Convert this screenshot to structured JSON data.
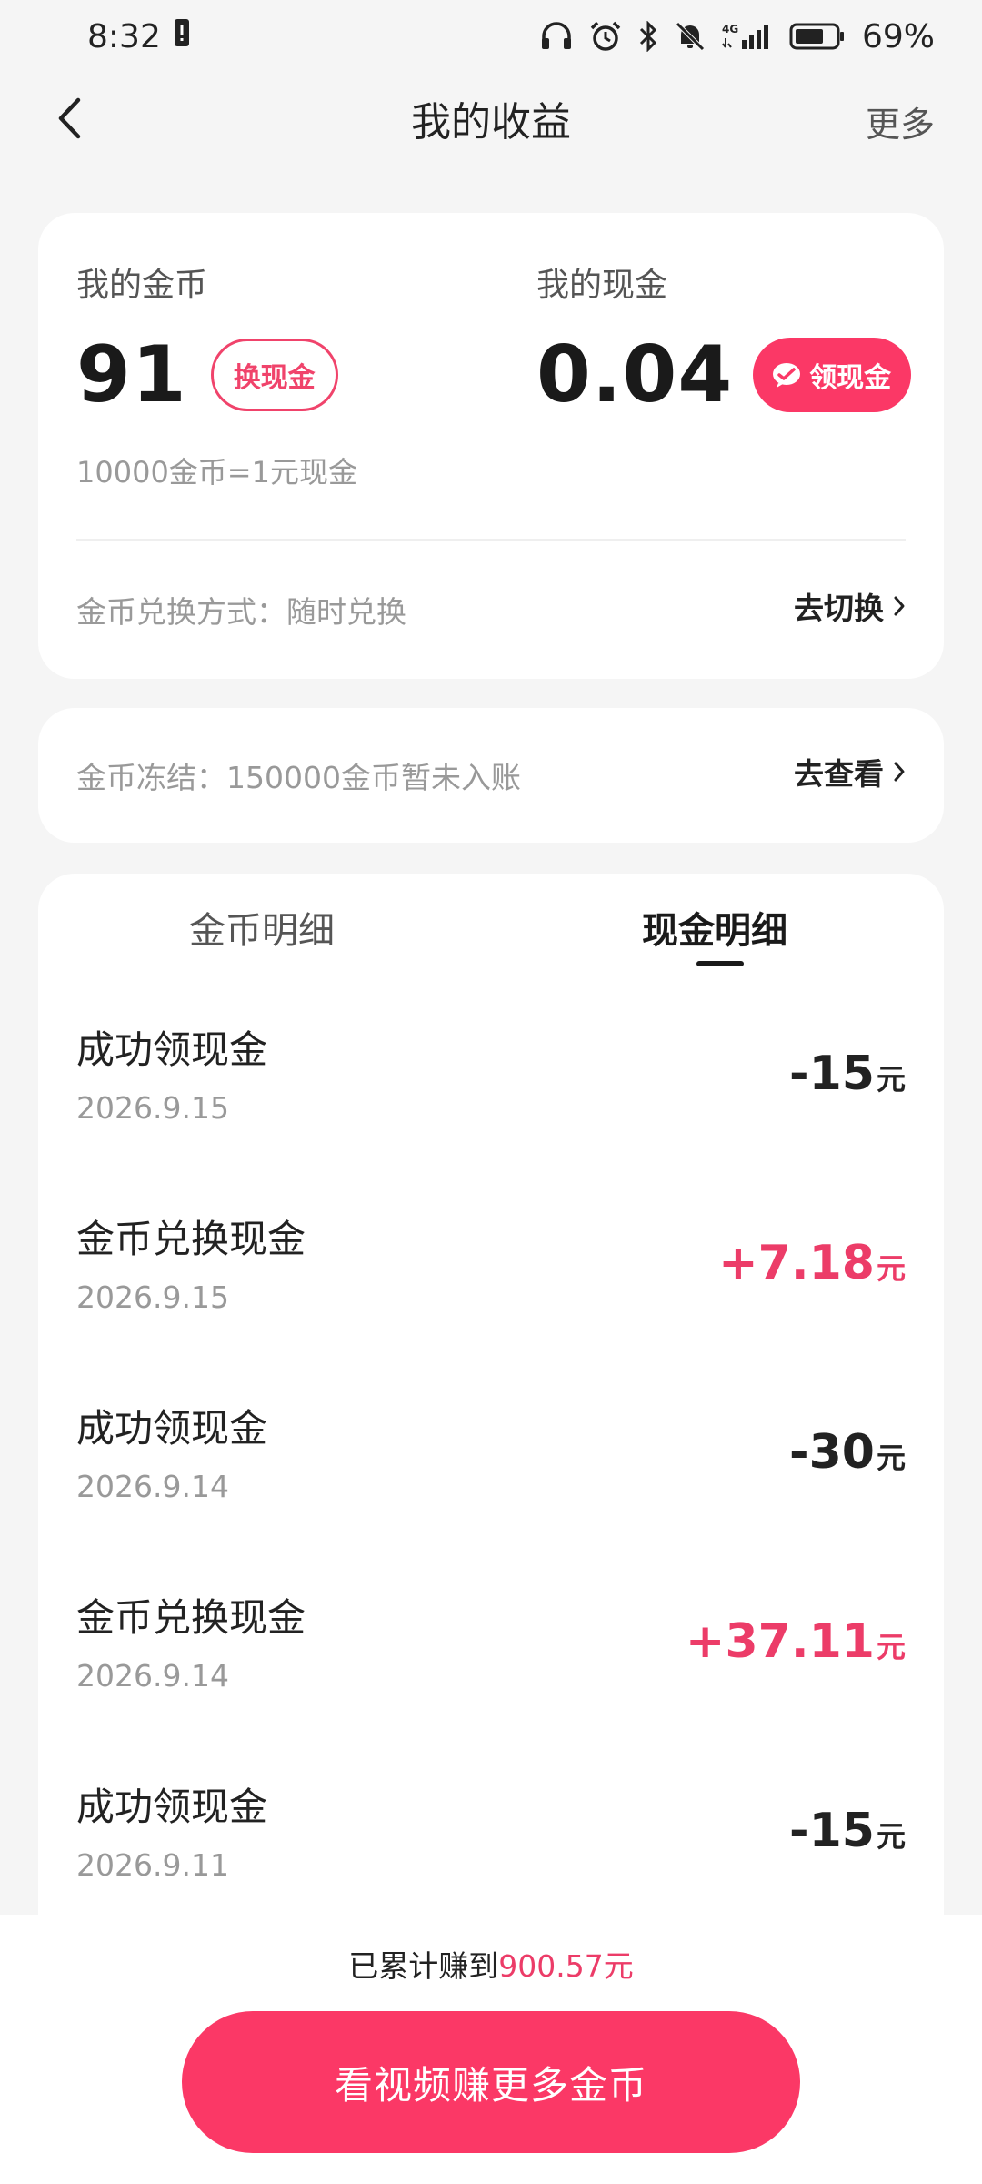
{
  "status_bar": {
    "time": "8:32",
    "network": "4G",
    "battery": "69%"
  },
  "nav": {
    "title": "我的收益",
    "more": "更多"
  },
  "balance": {
    "coins_label": "我的金币",
    "coins_value": "91",
    "exchange_button": "换现金",
    "cash_label": "我的现金",
    "cash_value": "0.04",
    "withdraw_button": "领现金",
    "rate": "10000金币=1元现金",
    "exchange_mode": "金币兑换方式：随时兑换",
    "switch_link": "去切换"
  },
  "frozen": {
    "text": "金币冻结：150000金币暂未入账",
    "view_link": "去查看"
  },
  "tabs": {
    "coin_details": "金币明细",
    "cash_details": "现金明细",
    "active": "cash_details"
  },
  "records": [
    {
      "title": "成功领现金",
      "date": "2026.9.15",
      "amount": "-15",
      "unit": "元",
      "positive": false
    },
    {
      "title": "金币兑换现金",
      "date": "2026.9.15",
      "amount": "+7.18",
      "unit": "元",
      "positive": true
    },
    {
      "title": "成功领现金",
      "date": "2026.9.14",
      "amount": "-30",
      "unit": "元",
      "positive": false
    },
    {
      "title": "金币兑换现金",
      "date": "2026.9.14",
      "amount": "+37.11",
      "unit": "元",
      "positive": true
    },
    {
      "title": "成功领现金",
      "date": "2026.9.11",
      "amount": "-15",
      "unit": "元",
      "positive": false
    }
  ],
  "footer": {
    "total_prefix": "已累计赚到",
    "total_amount": "900.57元",
    "cta": "看视频赚更多金币"
  },
  "colors": {
    "accent": "#fb3866",
    "positive_amount": "#ec3c68",
    "background": "#f5f5f5"
  }
}
